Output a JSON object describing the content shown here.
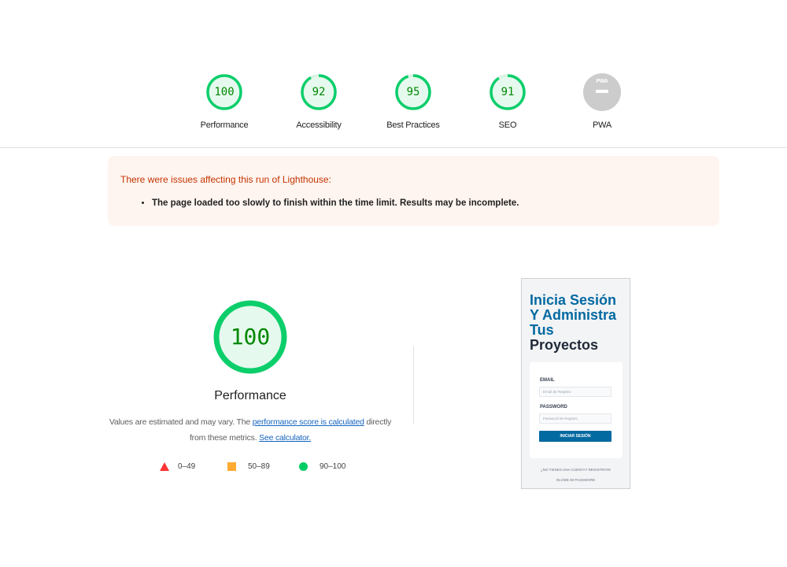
{
  "scores": [
    {
      "value": "100",
      "label": "Performance",
      "score": 100
    },
    {
      "value": "92",
      "label": "Accessibility",
      "score": 92
    },
    {
      "value": "95",
      "label": "Best Practices",
      "score": 95
    },
    {
      "value": "91",
      "label": "SEO",
      "score": 91
    },
    {
      "value": "",
      "label": "PWA",
      "badge_text": "PWA"
    }
  ],
  "warning": {
    "title": "There were issues affecting this run of Lighthouse:",
    "items": [
      "The page loaded too slowly to finish within the time limit. Results may be incomplete."
    ]
  },
  "performance": {
    "score": "100",
    "title": "Performance",
    "note_before": "Values are estimated and may vary. The ",
    "note_link": "performance score is calculated",
    "note_after": " directly from these metrics. ",
    "calc_link": "See calculator."
  },
  "legend": [
    {
      "range": "0–49",
      "color": "#ff3333"
    },
    {
      "range": "50–89",
      "color": "#ffaa33"
    },
    {
      "range": "90–100",
      "color": "#00cc66"
    }
  ],
  "thumbnail": {
    "heading_blue": [
      "Inicia Sesión",
      "Y Administra",
      "Tus"
    ],
    "heading_dark": "Proyectos",
    "email_label": "EMAIL",
    "email_placeholder": "Email de Registro",
    "password_label": "PASSWORD",
    "password_placeholder": "Password de Registro",
    "submit": "INICIAR SESIÓN",
    "register_link": "¿NO TIENES UNA CUENTA? REGISTRATE",
    "forgot_link": "OLVIDE MI PASSWORD"
  },
  "colors": {
    "pass_green": "#0cce6b",
    "pass_text": "#008800",
    "pass_fill": "#e6f9ee",
    "warning_bg": "#fff5f0",
    "warning_text": "#c33300"
  }
}
